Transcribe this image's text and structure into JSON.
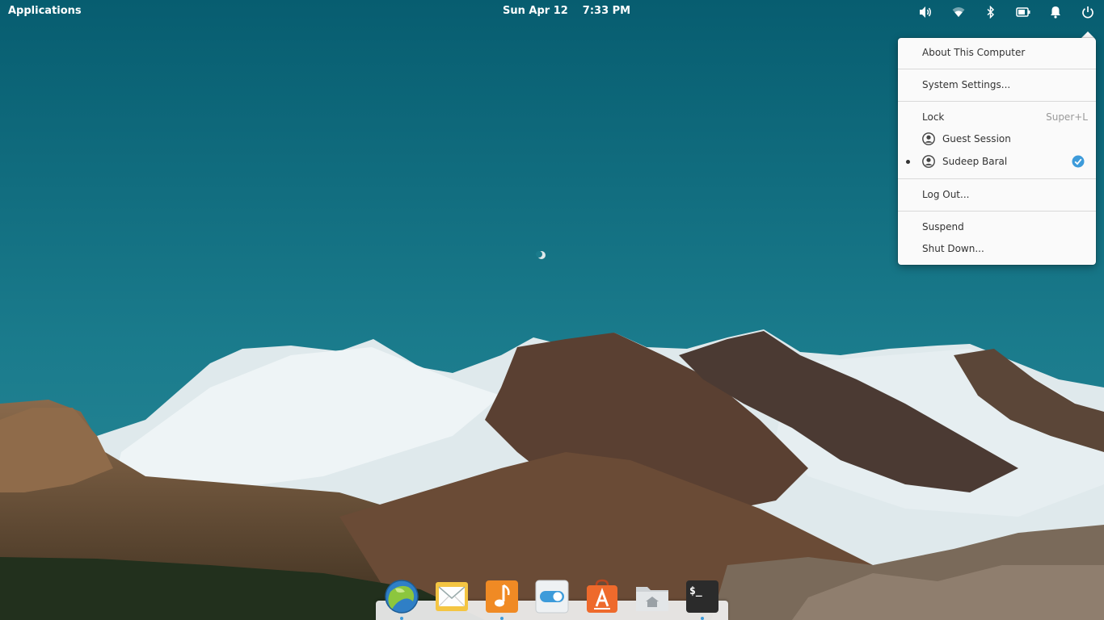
{
  "panel": {
    "applications_label": "Applications",
    "date": "Sun Apr 12",
    "time": "7:33 PM",
    "indicators": [
      "volume-icon",
      "wifi-icon",
      "bluetooth-icon",
      "battery-icon",
      "notifications-icon",
      "power-icon"
    ]
  },
  "session_menu": {
    "about": "About This Computer",
    "settings": "System Settings...",
    "lock": "Lock",
    "lock_shortcut": "Super+L",
    "guest": "Guest Session",
    "user": "Sudeep Baral",
    "logout": "Log Out...",
    "suspend": "Suspend",
    "shutdown": "Shut Down..."
  },
  "dock": {
    "items": [
      "web-browser-icon",
      "mail-icon",
      "music-icon",
      "system-settings-icon",
      "app-center-icon",
      "files-icon",
      "terminal-icon"
    ],
    "terminal_prompt": "$_"
  },
  "colors": {
    "accent": "#3d9bda",
    "sky": "#0b6478",
    "menu_bg": "#fafafa"
  }
}
